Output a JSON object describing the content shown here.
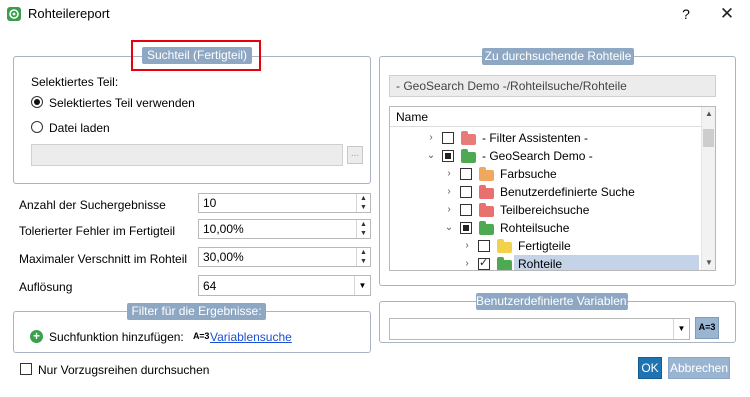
{
  "window": {
    "title": "Rohteilereport",
    "help_label": "?",
    "close_label": "✕"
  },
  "search_part": {
    "group_title": "Suchteil (Fertigteil)",
    "selected_label": "Selektiertes Teil:",
    "option_use_selected": "Selektiertes Teil verwenden",
    "option_load_file": "Datei laden",
    "selected_option": "Selektiertes Teil verwenden",
    "file_path": "",
    "browse_label": "..."
  },
  "params": {
    "result_count_label": "Anzahl der Suchergebnisse",
    "result_count_value": "10",
    "tolerance_label": "Tolerierter Fehler im Fertigteil",
    "tolerance_value": "10,00%",
    "max_waste_label": "Maximaler Verschnitt im Rohteil",
    "max_waste_value": "30,00%",
    "resolution_label": "Auflösung",
    "resolution_value": "64"
  },
  "filter": {
    "group_title": "Filter für die Ergebnisse:",
    "add_search_label": "Suchfunktion hinzufügen:",
    "var_icon_text": "A=3",
    "var_search_link": "Variablensuche"
  },
  "preferred_only_label": "Nur Vorzugsreihen durchsuchen",
  "tree": {
    "group_title": "Zu durchsuchende Rohteile",
    "path": "- GeoSearch Demo -/Rohteilsuche/Rohteile",
    "column_header": "Name",
    "rows": [
      {
        "label": "- Filter Assistenten -",
        "expander": "›",
        "check": "none",
        "folder_color": "#e87a7a"
      },
      {
        "label": "- GeoSearch Demo -",
        "expander": "⌄",
        "check": "partial",
        "folder_color": "#4daa52"
      },
      {
        "label": "Farbsuche",
        "expander": "›",
        "check": "none",
        "folder_color": "#f0a860"
      },
      {
        "label": "Benutzerdefinierte Suche",
        "expander": "›",
        "check": "none",
        "folder_color": "#e8706e"
      },
      {
        "label": "Teilbereichsuche",
        "expander": "›",
        "check": "none",
        "folder_color": "#e8706e"
      },
      {
        "label": "Rohteilsuche",
        "expander": "⌄",
        "check": "partial",
        "folder_color": "#4daa52"
      },
      {
        "label": "Fertigteile",
        "expander": "›",
        "check": "none",
        "folder_color": "#f2d24a"
      },
      {
        "label": "Rohteile",
        "expander": "›",
        "check": "checked",
        "folder_color": "#4daa52"
      }
    ]
  },
  "user_vars": {
    "group_title": "Benutzerdefinierte Variablen:",
    "value": "",
    "var_button": "A=3"
  },
  "buttons": {
    "ok": "OK",
    "cancel": "Abbrechen"
  }
}
